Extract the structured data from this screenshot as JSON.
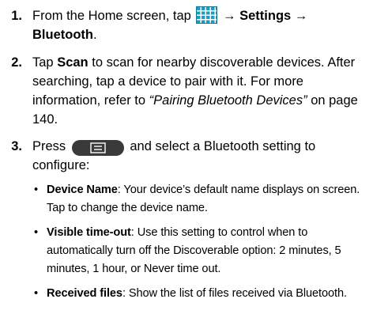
{
  "steps": [
    {
      "number": "1.",
      "text_before_icon": "From the Home screen, tap",
      "arrow_1": "→",
      "settings_label": "Settings",
      "arrow_2": "→",
      "bluetooth_label": "Bluetooth",
      "end_period": "."
    },
    {
      "number": "2.",
      "tap_label": "Tap",
      "scan_label": "Scan",
      "text_main": "to scan for nearby discoverable devices. After searching, tap a device to pair with it. For more information, refer to",
      "reference_title": "“Pairing Bluetooth Devices”",
      "text_end": "on page 140."
    },
    {
      "number": "3.",
      "press_label": "Press",
      "text_after_key": "and select a Bluetooth setting to configure:",
      "bullets": [
        {
          "bullet_char": "•",
          "term": "Device Name",
          "description": ": Your device’s default name displays on screen. Tap to change the device name."
        },
        {
          "bullet_char": "•",
          "term": "Visible time-out",
          "description": ": Use this setting to control when to automatically turn off the Discoverable option: 2 minutes, 5 minutes, 1 hour, or Never time out."
        },
        {
          "bullet_char": "•",
          "term": "Received files",
          "description": ": Show the list of files received via Bluetooth."
        }
      ]
    }
  ],
  "icons": {
    "apps_icon": "apps-grid-icon",
    "menu_key_icon": "menu-key-icon",
    "apps_icon_color": "#1b9cc1",
    "menu_key_color": "#3a3a3a"
  }
}
